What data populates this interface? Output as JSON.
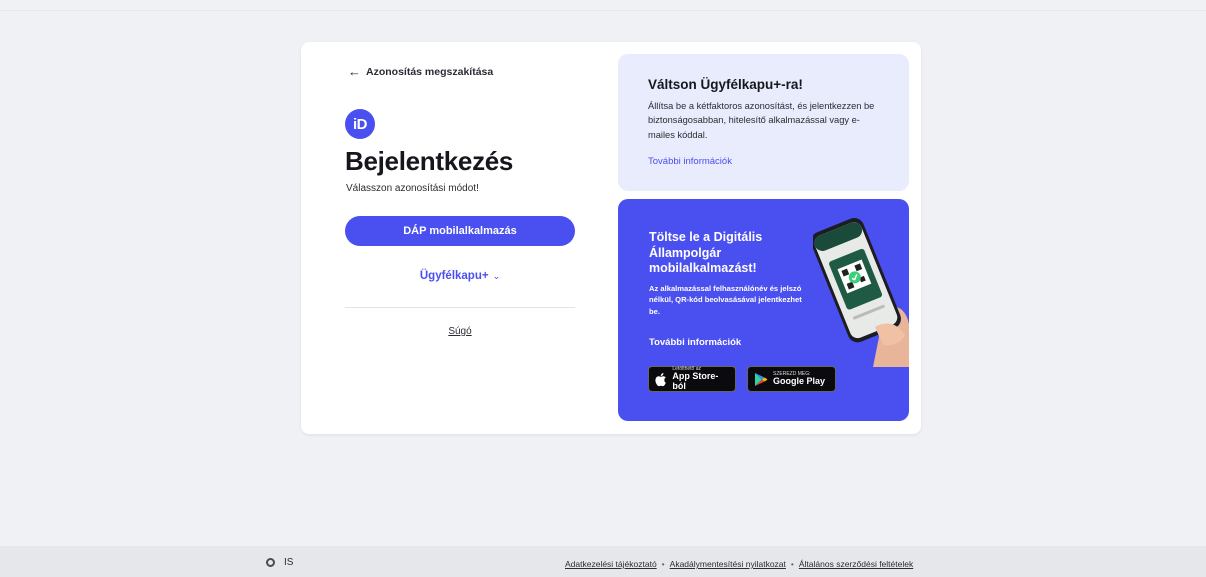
{
  "login": {
    "back_label": "Azonosítás megszakítása",
    "logo_text": "iD",
    "title": "Bejelentkezés",
    "subtitle": "Válasszon azonosítási módot!",
    "primary_button": "DÁP mobilalkalmazás",
    "secondary_option": "Ügyfélkapu+",
    "help_link": "Súgó"
  },
  "upgrade_panel": {
    "title": "Váltson Ügyfélkapu+-ra!",
    "text": "Állítsa be a kétfaktoros azonosítást, és jelentkezzen be biztonságosabban, hitelesítő alkalmazással vagy e-mailes kóddal.",
    "link": "További információk",
    "bg_color": "#e8ecfd"
  },
  "app_panel": {
    "title": "Töltse le a Digitális Állampolgár mobilalkalmazást!",
    "text": "Az alkalmazással felhasználónév és jelszó nélkül, QR-kód beolvasásával jelentkezhet be.",
    "link": "További információk",
    "bg_color": "#4a4ff0",
    "app_store": {
      "small": "Letölthető az",
      "big": "App Store-ból",
      "icon": "apple-icon"
    },
    "google_play": {
      "small": "SZEREZD MEG:",
      "big": "Google Play",
      "icon": "google-play-icon"
    }
  },
  "footer": {
    "language": "IS",
    "links": [
      "Adatkezelési tájékoztató",
      "Akadálymentesítési nyilatkozat",
      "Általános szerződési feltételek"
    ],
    "separator": "•"
  },
  "colors": {
    "accent": "#4a4ff0",
    "background": "#f0f1f4"
  }
}
